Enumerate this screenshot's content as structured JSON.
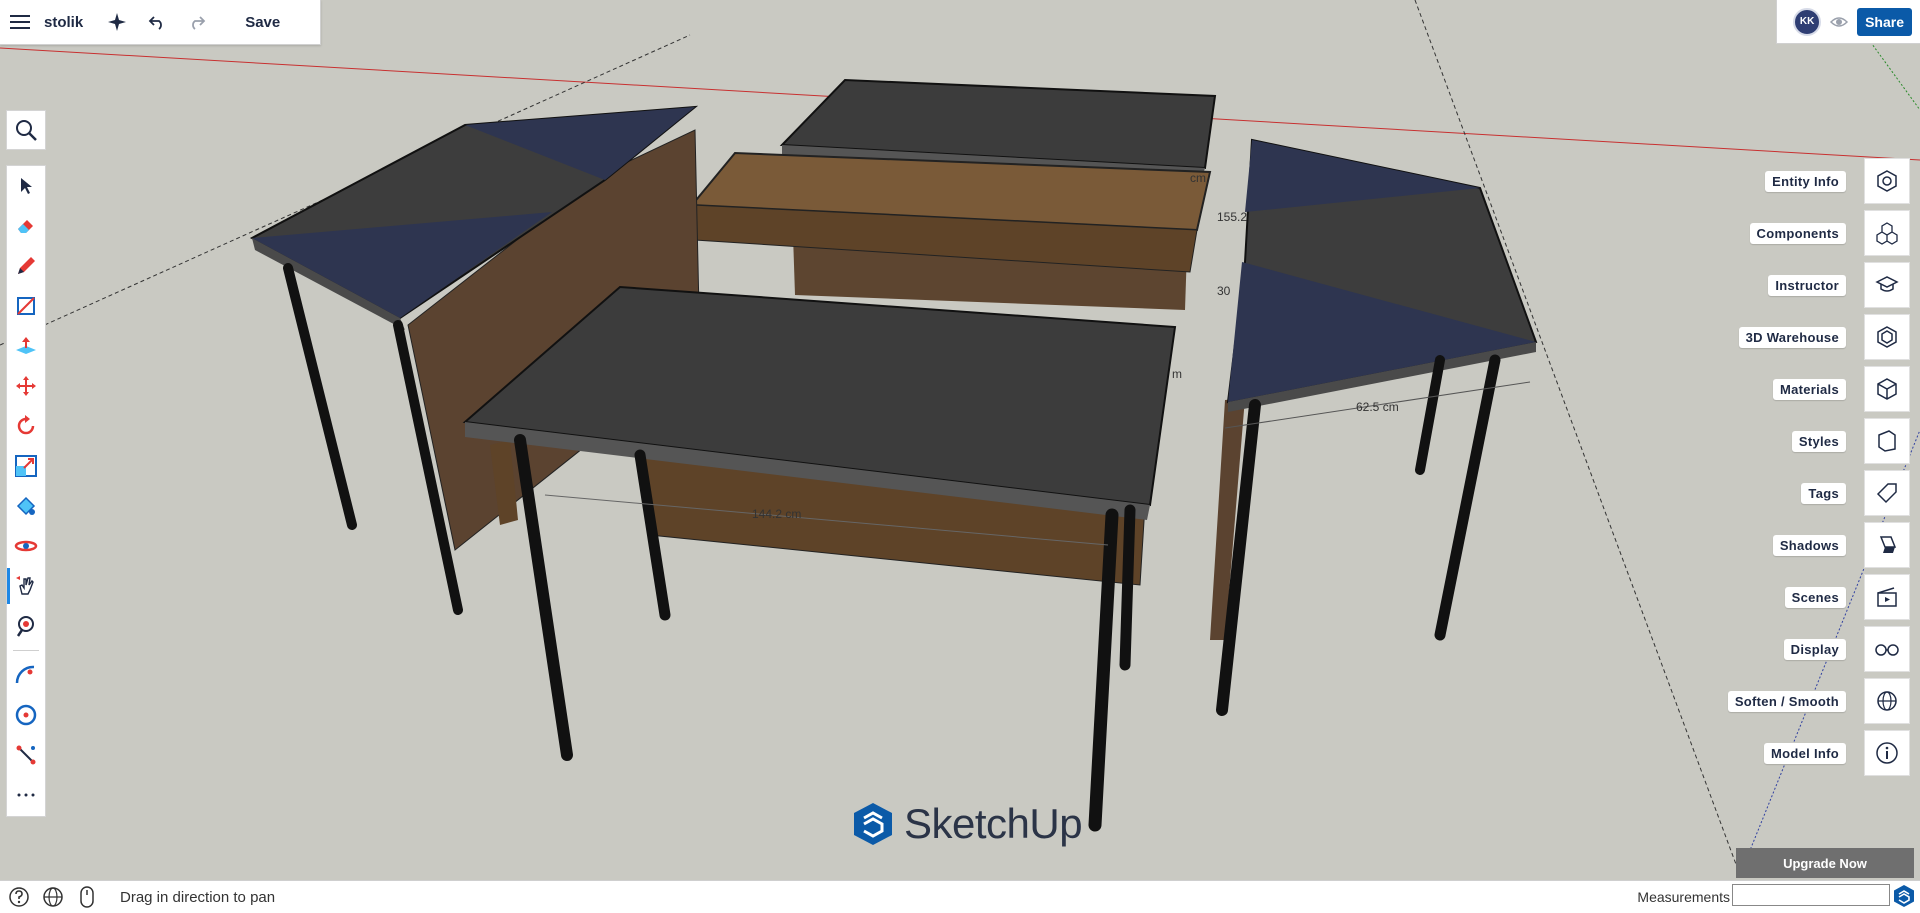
{
  "app": {
    "title": "stolik",
    "save_label": "Save"
  },
  "user": {
    "initials": "KK"
  },
  "share_label": "Share",
  "right_panel": [
    {
      "label": "Entity Info",
      "icon": "entity-info-icon"
    },
    {
      "label": "Components",
      "icon": "components-icon"
    },
    {
      "label": "Instructor",
      "icon": "instructor-icon"
    },
    {
      "label": "3D Warehouse",
      "icon": "warehouse-icon"
    },
    {
      "label": "Materials",
      "icon": "materials-icon"
    },
    {
      "label": "Styles",
      "icon": "styles-icon"
    },
    {
      "label": "Tags",
      "icon": "tags-icon"
    },
    {
      "label": "Shadows",
      "icon": "shadows-icon"
    },
    {
      "label": "Scenes",
      "icon": "scenes-icon"
    },
    {
      "label": "Display",
      "icon": "display-icon"
    },
    {
      "label": "Soften / Smooth",
      "icon": "soften-smooth-icon"
    },
    {
      "label": "Model Info",
      "icon": "model-info-icon"
    }
  ],
  "tools": [
    "select-tool-icon",
    "eraser-tool-icon",
    "pencil-tool-icon",
    "rectangle-tool-icon",
    "push-pull-tool-icon",
    "move-tool-icon",
    "rotate-tool-icon",
    "scale-tool-icon",
    "paint-bucket-tool-icon",
    "orbit-tool-icon",
    "pan-tool-icon",
    "zoom-tool-icon",
    "arc-tool-icon",
    "tape-measure-tool-icon",
    "dimension-tool-icon",
    "more-tools-icon"
  ],
  "upgrade_label": "Upgrade Now",
  "status": {
    "hint": "Drag in direction to pan",
    "measurements_label": "Measurements",
    "measurements_value": ""
  },
  "brand": "SketchUp",
  "dimensions": [
    "144.2 cm",
    "62.5 cm",
    "155.2",
    "30",
    "cm",
    "m"
  ],
  "colors": {
    "accent": "#0b5aa8",
    "background": "#c9c9c2",
    "axis_red": "#cc2222"
  }
}
